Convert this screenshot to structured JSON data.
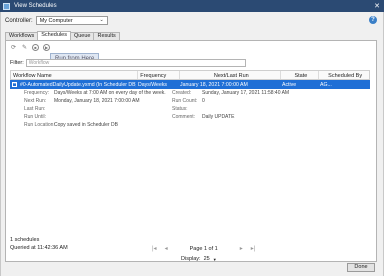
{
  "window": {
    "title": "View Schedules",
    "close": "✕"
  },
  "controller": {
    "label": "Controller:",
    "value": "My Computer"
  },
  "tabs": [
    "Workflows",
    "Schedules",
    "Queue",
    "Results"
  ],
  "toolbar": {
    "tooltip": "Run from Here"
  },
  "filter": {
    "label": "Filter:",
    "placeholder": "Workflow"
  },
  "table": {
    "headers": [
      "Workflow Name",
      "Frequency",
      "Next/Last Run",
      "State",
      "Scheduled By"
    ],
    "row": {
      "name": "#0-AutomatedDailyUpdate.yxmd (In Scheduler DB)",
      "frequency": "Days/Weeks",
      "next_last_run": "January 18, 2021 7:00:00 AM",
      "state": "Active",
      "scheduled_by": "AG..."
    },
    "details": {
      "frequency_label": "Frequency:",
      "frequency": "Days/Weeks at 7:00 AM on every day of the week.",
      "next_run_label": "Next Run:",
      "next_run": "Monday, January 18, 2021 7:00:00 AM",
      "last_run_label": "Last Run:",
      "run_until_label": "Run Until:",
      "run_location_label": "Run Location:",
      "run_location": "Copy saved in Scheduler DB",
      "created_label": "Created:",
      "created": "Sunday, January 17, 2021 11:58:40 AM",
      "run_count_label": "Run Count:",
      "run_count": "0",
      "status_label": "Status:",
      "comment_label": "Comment:",
      "comment": "Daily UPDATE"
    }
  },
  "footer": {
    "count": "1 schedules",
    "queried": "Queried at 11:42:36 AM",
    "page": "Page 1 of 1",
    "display_label": "Display:",
    "display_value": "25",
    "done": "Done"
  }
}
